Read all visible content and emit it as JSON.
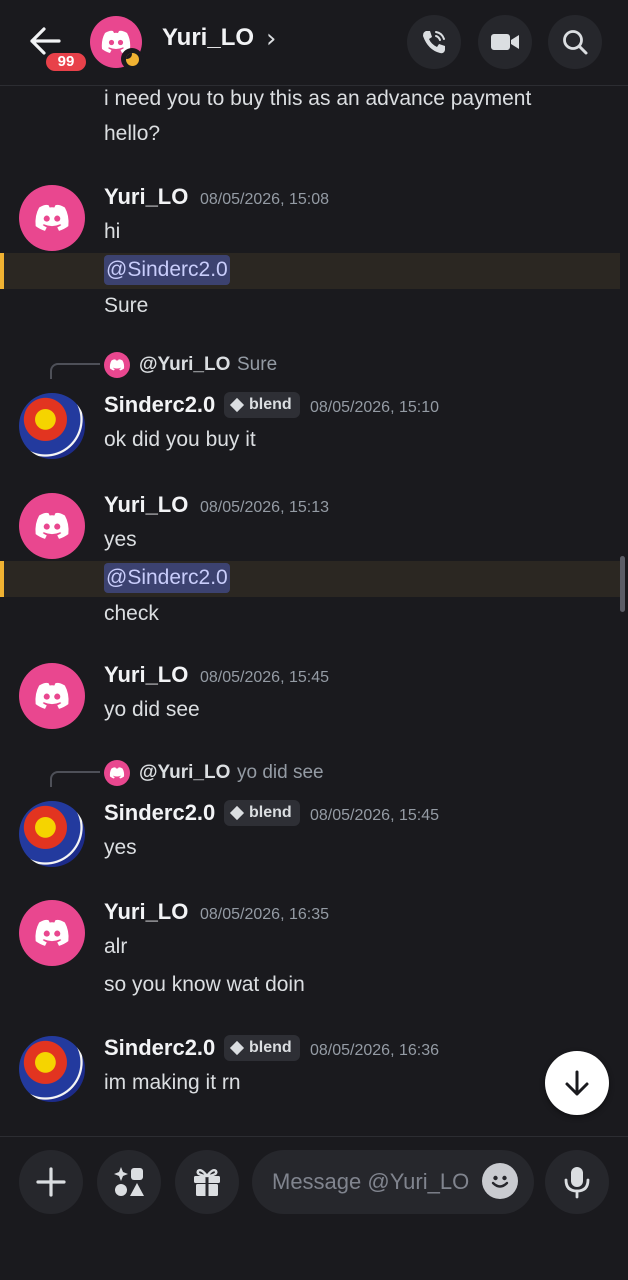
{
  "header": {
    "unread_badge": "99",
    "contact_name": "Yuri_LO",
    "chevron": "›",
    "icons": {
      "back": "arrow-left-icon",
      "call": "phone-call-icon",
      "video": "video-camera-icon",
      "search": "search-icon"
    },
    "status_color": "#f0b232"
  },
  "messages": {
    "top_partial": {
      "lines": [
        "i need you to buy this as an advance payment",
        "hello?"
      ]
    },
    "m1": {
      "author": "Yuri_LO",
      "timestamp": "08/05/2026, 15:08",
      "lines": [
        "hi"
      ],
      "mention": "@Sinderc2.0",
      "after_mention": "Sure"
    },
    "m2": {
      "reply": {
        "author": "@Yuri_LO",
        "text": "Sure"
      },
      "author": "Sinderc2.0",
      "tag": "blend",
      "timestamp": "08/05/2026, 15:10",
      "lines": [
        "ok did you buy it"
      ]
    },
    "m3": {
      "author": "Yuri_LO",
      "timestamp": "08/05/2026, 15:13",
      "lines": [
        "yes"
      ],
      "mention": "@Sinderc2.0",
      "after_mention": "check"
    },
    "m4": {
      "author": "Yuri_LO",
      "timestamp": "08/05/2026, 15:45",
      "lines": [
        "yo did see"
      ]
    },
    "m5": {
      "reply": {
        "author": "@Yuri_LO",
        "text": "yo did see"
      },
      "author": "Sinderc2.0",
      "tag": "blend",
      "timestamp": "08/05/2026, 15:45",
      "lines": [
        "yes"
      ]
    },
    "m6": {
      "author": "Yuri_LO",
      "timestamp": "08/05/2026, 16:35",
      "lines": [
        "alr",
        "so you know wat doin"
      ]
    },
    "m7": {
      "author": "Sinderc2.0",
      "tag": "blend",
      "timestamp": "08/05/2026, 16:36",
      "lines": [
        "im making it rn"
      ]
    }
  },
  "composer": {
    "placeholder": "Message @Yuri_LO",
    "icons": {
      "add": "plus-icon",
      "apps": "apps-icon",
      "gift": "gift-icon",
      "emoji": "emoji-icon",
      "voice": "microphone-icon",
      "jump": "arrow-down-icon"
    }
  },
  "colors": {
    "accent_pink": "#e9478f",
    "mention_bg": "#3c4270",
    "highlight_border": "#f0b232"
  }
}
